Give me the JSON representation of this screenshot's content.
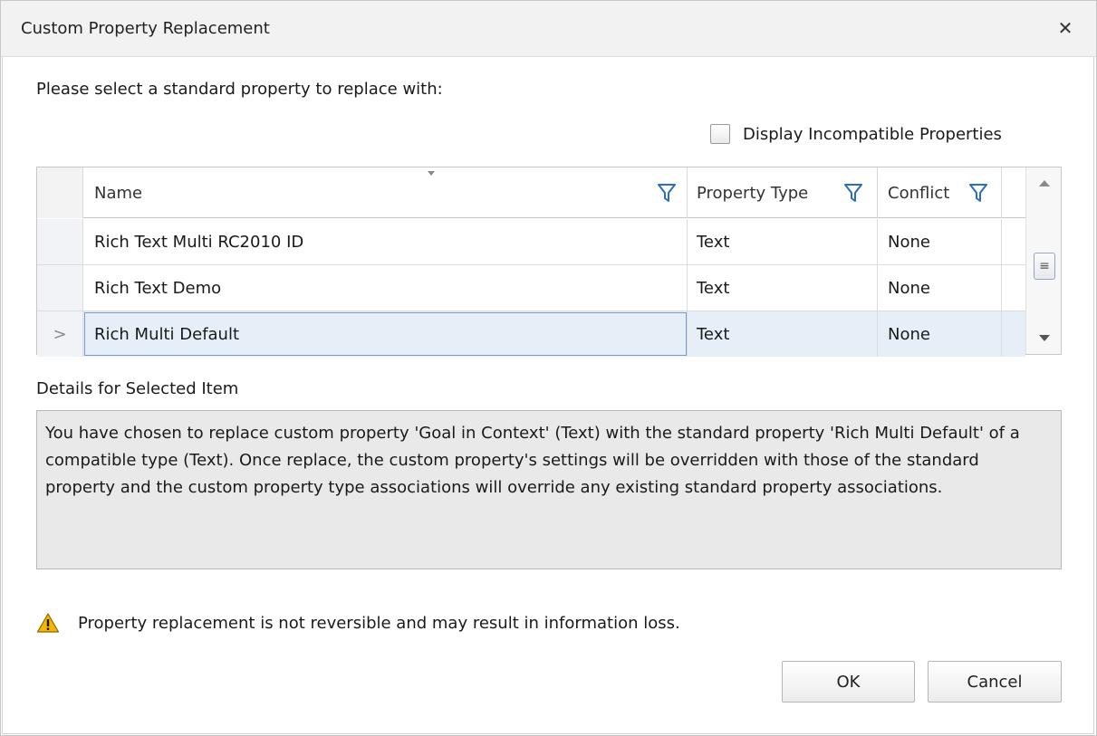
{
  "window": {
    "title": "Custom Property Replacement"
  },
  "prompt": "Please select a standard property to replace with:",
  "incompatible_checkbox": {
    "label": "Display Incompatible Properties",
    "checked": false
  },
  "grid": {
    "columns": {
      "name": "Name",
      "property_type": "Property Type",
      "conflict": "Conflict"
    },
    "rows": [
      {
        "name": "Rich Text Multi RC2010 ID",
        "property_type": "Text",
        "conflict": "None",
        "selected": false
      },
      {
        "name": "Rich Text Demo",
        "property_type": "Text",
        "conflict": "None",
        "selected": false
      },
      {
        "name": "Rich Multi Default",
        "property_type": "Text",
        "conflict": "None",
        "selected": true
      }
    ],
    "selected_indicator": ">",
    "scroll_thumb_glyph": "≡"
  },
  "details": {
    "label": "Details for Selected Item",
    "text": "You have chosen to replace custom property 'Goal in Context' (Text) with the standard property 'Rich Multi Default' of a compatible type (Text). Once replace, the custom property's settings will be overridden with those of the standard property and the custom property type associations will override any existing standard property associations."
  },
  "warning": {
    "icon": "warning-triangle-icon",
    "text": "Property replacement is not reversible and may result in information loss."
  },
  "buttons": {
    "ok": "OK",
    "cancel": "Cancel"
  },
  "colors": {
    "filter_icon": "#2b6cc4",
    "selected_row": "#e6eef8",
    "warning_icon": "#f2b705"
  }
}
